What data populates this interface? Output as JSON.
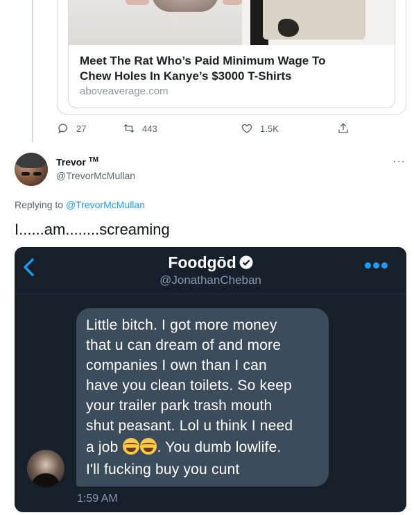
{
  "card": {
    "title_line1": "Meet The Rat Who’s Paid Minimum Wage To",
    "title_line2": "Chew Holes In Kanye’s $3000 T-Shirts",
    "domain": "aboveaverage.com"
  },
  "actions": {
    "reply_count": "27",
    "retweet_count": "443",
    "like_count": "1.5K",
    "icons": [
      "reply-icon",
      "retweet-icon",
      "like-icon",
      "share-icon"
    ]
  },
  "tweet": {
    "display_name": "Trevor",
    "display_name_suffix": "TM",
    "handle": "@TrevorMcMullan",
    "more": "···",
    "replying_prefix": "Replying to ",
    "replying_mention": "@TrevorMcMullan",
    "text": "I......am........screaming"
  },
  "dm": {
    "name": "Foodgōd",
    "handle": "@JonathanCheban",
    "message_lines": [
      "Little bitch. I got more money",
      "that u can dream of and more",
      "companies I own than I can",
      "have you clean toilets. So keep",
      "your trailer park trash mouth",
      "shut peasant. Lol u think I need"
    ],
    "message_line_emoji_before": "a job ",
    "message_line_emoji_after": ". You dumb lowlife.",
    "message_last_line": "I'll fucking buy you cunt",
    "time": "1:59 AM",
    "accent_color": "#1d9bf0",
    "background_color": "#15202b",
    "bubble_color": "#3d4c5c"
  }
}
